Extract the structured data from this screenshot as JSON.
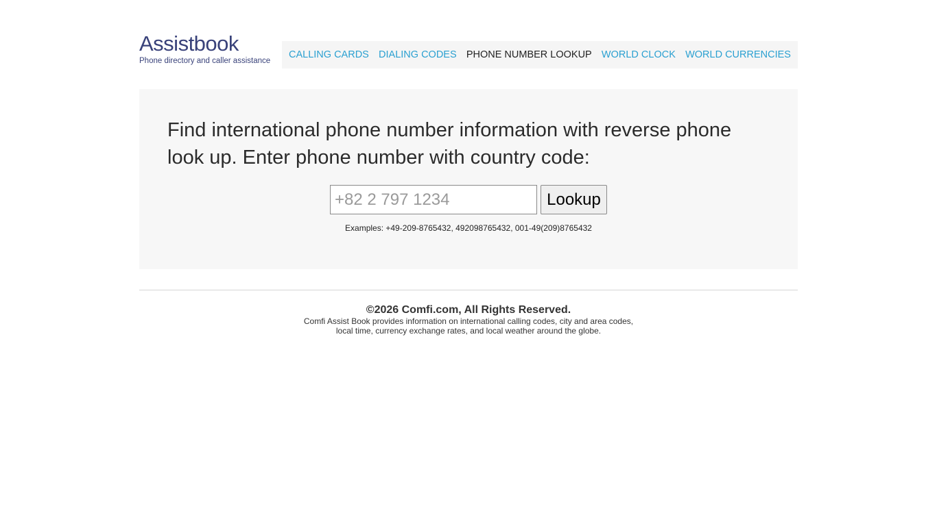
{
  "logo": {
    "title": "Assistbook",
    "subtitle": "Phone directory and caller assistance"
  },
  "nav": {
    "items": [
      {
        "label": "CALLING CARDS",
        "active": false
      },
      {
        "label": "DIALING CODES",
        "active": false
      },
      {
        "label": "PHONE NUMBER LOOKUP",
        "active": true
      },
      {
        "label": "WORLD CLOCK",
        "active": false
      },
      {
        "label": "WORLD CURRENCIES",
        "active": false
      }
    ]
  },
  "main": {
    "headline": "Find international phone number information with reverse phone look up. Enter phone number with country code:",
    "search": {
      "placeholder": "+82 2 797 1234",
      "value": ""
    },
    "lookup_label": "Lookup",
    "examples": "Examples: +49-209-8765432, 492098765432, 001-49(209)8765432"
  },
  "footer": {
    "copyright": "©2026 Comfi.com, All Rights Reserved.",
    "desc_line1": "Comfi Assist Book provides information on international calling codes, city and area codes,",
    "desc_line2": "local time, currency exchange rates, and local weather around the globe."
  },
  "colors": {
    "link": "#2aa0d1",
    "brand": "#39427a",
    "panel_bg": "#f7f7f7",
    "nav_bg": "#f5f5f5"
  }
}
